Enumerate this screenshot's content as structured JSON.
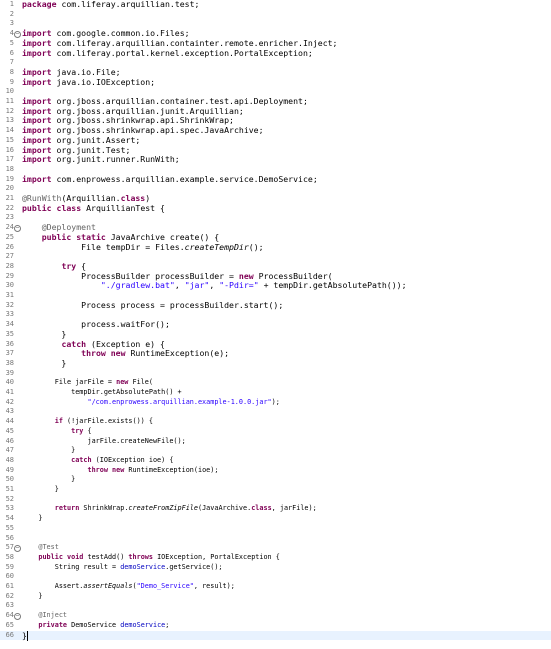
{
  "editor": {
    "language": "java",
    "highlight_line": 66,
    "colors": {
      "keyword": "#7f0055",
      "string": "#2a00ff",
      "annotation": "#646464",
      "field": "#0000c0",
      "line_number": "#787878",
      "current_line": "#e8f2fe"
    },
    "lines": [
      {
        "n": 1,
        "tokens": [
          [
            "kw",
            "package"
          ],
          [
            "t",
            " com.liferay.arquillian.test;"
          ]
        ]
      },
      {
        "n": 2,
        "tokens": []
      },
      {
        "n": 3,
        "tokens": []
      },
      {
        "n": 4,
        "fold": true,
        "tokens": [
          [
            "kw",
            "import"
          ],
          [
            "t",
            " com.google.common.io.Files;"
          ]
        ]
      },
      {
        "n": 5,
        "tokens": [
          [
            "kw",
            "import"
          ],
          [
            "t",
            " com.liferay.arquillian.containter.remote.enricher.Inject;"
          ]
        ]
      },
      {
        "n": 6,
        "tokens": [
          [
            "kw",
            "import"
          ],
          [
            "t",
            " com.liferay.portal.kernel.exception.PortalException;"
          ]
        ]
      },
      {
        "n": 7,
        "tokens": []
      },
      {
        "n": 8,
        "tokens": [
          [
            "kw",
            "import"
          ],
          [
            "t",
            " java.io.File;"
          ]
        ]
      },
      {
        "n": 9,
        "tokens": [
          [
            "kw",
            "import"
          ],
          [
            "t",
            " java.io.IOException;"
          ]
        ]
      },
      {
        "n": 10,
        "tokens": []
      },
      {
        "n": 11,
        "tokens": [
          [
            "kw",
            "import"
          ],
          [
            "t",
            " org.jboss.arquillian.container.test.api.Deployment;"
          ]
        ]
      },
      {
        "n": 12,
        "tokens": [
          [
            "kw",
            "import"
          ],
          [
            "t",
            " org.jboss.arquillian.junit.Arquillian;"
          ]
        ]
      },
      {
        "n": 13,
        "tokens": [
          [
            "kw",
            "import"
          ],
          [
            "t",
            " org.jboss.shrinkwrap.api.ShrinkWrap;"
          ]
        ]
      },
      {
        "n": 14,
        "tokens": [
          [
            "kw",
            "import"
          ],
          [
            "t",
            " org.jboss.shrinkwrap.api.spec.JavaArchive;"
          ]
        ]
      },
      {
        "n": 15,
        "tokens": [
          [
            "kw",
            "import"
          ],
          [
            "t",
            " org.junit.Assert;"
          ]
        ]
      },
      {
        "n": 16,
        "tokens": [
          [
            "kw",
            "import"
          ],
          [
            "t",
            " org.junit.Test;"
          ]
        ]
      },
      {
        "n": 17,
        "tokens": [
          [
            "kw",
            "import"
          ],
          [
            "t",
            " org.junit.runner.RunWith;"
          ]
        ]
      },
      {
        "n": 18,
        "tokens": []
      },
      {
        "n": 19,
        "tokens": [
          [
            "kw",
            "import"
          ],
          [
            "t",
            " com.enprowess.arquillian.example.service.DemoService;"
          ]
        ]
      },
      {
        "n": 20,
        "tokens": []
      },
      {
        "n": 21,
        "tokens": [
          [
            "ann",
            "@RunWith"
          ],
          [
            "t",
            "(Arquillian."
          ],
          [
            "kw",
            "class"
          ],
          [
            "t",
            ")"
          ]
        ]
      },
      {
        "n": 22,
        "tokens": [
          [
            "kw",
            "public"
          ],
          [
            "t",
            " "
          ],
          [
            "kw",
            "class"
          ],
          [
            "t",
            " ArquillianTest {"
          ]
        ]
      },
      {
        "n": 23,
        "tokens": []
      },
      {
        "n": 24,
        "fold": true,
        "tokens": [
          [
            "t",
            "    "
          ],
          [
            "ann",
            "@Deployment"
          ]
        ]
      },
      {
        "n": 25,
        "tokens": [
          [
            "t",
            "    "
          ],
          [
            "kw",
            "public"
          ],
          [
            "t",
            " "
          ],
          [
            "kw",
            "static"
          ],
          [
            "t",
            " JavaArchive create() {"
          ]
        ]
      },
      {
        "n": 26,
        "tokens": [
          [
            "t",
            "            File tempDir = Files."
          ],
          [
            "sm",
            "createTempDir"
          ],
          [
            "t",
            "();"
          ]
        ]
      },
      {
        "n": 27,
        "tokens": []
      },
      {
        "n": 28,
        "tokens": [
          [
            "t",
            "        "
          ],
          [
            "kw",
            "try"
          ],
          [
            "t",
            " {"
          ]
        ]
      },
      {
        "n": 29,
        "tokens": [
          [
            "t",
            "            ProcessBuilder processBuilder = "
          ],
          [
            "kw",
            "new"
          ],
          [
            "t",
            " ProcessBuilder("
          ]
        ]
      },
      {
        "n": 30,
        "tokens": [
          [
            "t",
            "                "
          ],
          [
            "str",
            "\"./gradlew.bat\""
          ],
          [
            "t",
            ", "
          ],
          [
            "str",
            "\"jar\""
          ],
          [
            "t",
            ", "
          ],
          [
            "str",
            "\"-Pdir=\""
          ],
          [
            "t",
            " + tempDir.getAbsolutePath());"
          ]
        ]
      },
      {
        "n": 31,
        "tokens": []
      },
      {
        "n": 32,
        "tokens": [
          [
            "t",
            "            Process process = processBuilder.start();"
          ]
        ]
      },
      {
        "n": 33,
        "tokens": []
      },
      {
        "n": 34,
        "tokens": [
          [
            "t",
            "            process.waitFor();"
          ]
        ]
      },
      {
        "n": 35,
        "tokens": [
          [
            "t",
            "        }"
          ]
        ]
      },
      {
        "n": 36,
        "tokens": [
          [
            "t",
            "        "
          ],
          [
            "kw",
            "catch"
          ],
          [
            "t",
            " (Exception e) {"
          ]
        ]
      },
      {
        "n": 37,
        "tokens": [
          [
            "t",
            "            "
          ],
          [
            "kw",
            "throw"
          ],
          [
            "t",
            " "
          ],
          [
            "kw",
            "new"
          ],
          [
            "t",
            " RuntimeException(e);"
          ]
        ]
      },
      {
        "n": 38,
        "tokens": [
          [
            "t",
            "        }"
          ]
        ]
      },
      {
        "n": 39,
        "tokens": []
      },
      {
        "n": 40,
        "small": true,
        "tokens": [
          [
            "t",
            "        File jarFile = "
          ],
          [
            "kw",
            "new"
          ],
          [
            "t",
            " File("
          ]
        ]
      },
      {
        "n": 41,
        "small": true,
        "tokens": [
          [
            "t",
            "            tempDir.getAbsolutePath() +"
          ]
        ]
      },
      {
        "n": 42,
        "small": true,
        "tokens": [
          [
            "t",
            "                "
          ],
          [
            "str",
            "\"/com.enprowess.arquillian.example-1.0.0.jar\""
          ],
          [
            "t",
            ");"
          ]
        ]
      },
      {
        "n": 43,
        "small": true,
        "tokens": []
      },
      {
        "n": 44,
        "small": true,
        "tokens": [
          [
            "t",
            "        "
          ],
          [
            "kw",
            "if"
          ],
          [
            "t",
            " (!jarFile.exists()) {"
          ]
        ]
      },
      {
        "n": 45,
        "small": true,
        "tokens": [
          [
            "t",
            "            "
          ],
          [
            "kw",
            "try"
          ],
          [
            "t",
            " {"
          ]
        ]
      },
      {
        "n": 46,
        "small": true,
        "tokens": [
          [
            "t",
            "                jarFile.createNewFile();"
          ]
        ]
      },
      {
        "n": 47,
        "small": true,
        "tokens": [
          [
            "t",
            "            }"
          ]
        ]
      },
      {
        "n": 48,
        "small": true,
        "tokens": [
          [
            "t",
            "            "
          ],
          [
            "kw",
            "catch"
          ],
          [
            "t",
            " (IOException ioe) {"
          ]
        ]
      },
      {
        "n": 49,
        "small": true,
        "tokens": [
          [
            "t",
            "                "
          ],
          [
            "kw",
            "throw"
          ],
          [
            "t",
            " "
          ],
          [
            "kw",
            "new"
          ],
          [
            "t",
            " RuntimeException(ioe);"
          ]
        ]
      },
      {
        "n": 50,
        "small": true,
        "tokens": [
          [
            "t",
            "            }"
          ]
        ]
      },
      {
        "n": 51,
        "small": true,
        "tokens": [
          [
            "t",
            "        }"
          ]
        ]
      },
      {
        "n": 52,
        "small": true,
        "tokens": []
      },
      {
        "n": 53,
        "small": true,
        "tokens": [
          [
            "t",
            "        "
          ],
          [
            "kw",
            "return"
          ],
          [
            "t",
            " ShrinkWrap."
          ],
          [
            "sm",
            "createFromZipFile"
          ],
          [
            "t",
            "(JavaArchive."
          ],
          [
            "kw",
            "class"
          ],
          [
            "t",
            ", jarFile);"
          ]
        ]
      },
      {
        "n": 54,
        "small": true,
        "tokens": [
          [
            "t",
            "    }"
          ]
        ]
      },
      {
        "n": 55,
        "small": true,
        "tokens": []
      },
      {
        "n": 56,
        "small": true,
        "tokens": []
      },
      {
        "n": 57,
        "small": true,
        "fold": true,
        "tokens": [
          [
            "t",
            "    "
          ],
          [
            "ann",
            "@Test"
          ]
        ]
      },
      {
        "n": 58,
        "small": true,
        "tokens": [
          [
            "t",
            "    "
          ],
          [
            "kw",
            "public"
          ],
          [
            "t",
            " "
          ],
          [
            "kw",
            "void"
          ],
          [
            "t",
            " testAdd() "
          ],
          [
            "kw",
            "throws"
          ],
          [
            "t",
            " IOException, PortalException {"
          ]
        ]
      },
      {
        "n": 59,
        "small": true,
        "tokens": [
          [
            "t",
            "        String result = "
          ],
          [
            "fld",
            "demoService"
          ],
          [
            "t",
            ".getService();"
          ]
        ]
      },
      {
        "n": 60,
        "small": true,
        "tokens": []
      },
      {
        "n": 61,
        "small": true,
        "tokens": [
          [
            "t",
            "        Assert."
          ],
          [
            "sm",
            "assertEquals"
          ],
          [
            "t",
            "("
          ],
          [
            "str",
            "\"Demo_Service\""
          ],
          [
            "t",
            ", result);"
          ]
        ]
      },
      {
        "n": 62,
        "small": true,
        "tokens": [
          [
            "t",
            "    }"
          ]
        ]
      },
      {
        "n": 63,
        "small": true,
        "tokens": []
      },
      {
        "n": 64,
        "small": true,
        "fold": true,
        "tokens": [
          [
            "t",
            "    "
          ],
          [
            "ann",
            "@Inject"
          ]
        ]
      },
      {
        "n": 65,
        "small": true,
        "tokens": [
          [
            "t",
            "    "
          ],
          [
            "kw",
            "private"
          ],
          [
            "t",
            " DemoService "
          ],
          [
            "fld",
            "demoService"
          ],
          [
            "t",
            ";"
          ]
        ]
      },
      {
        "n": 66,
        "tokens": [
          [
            "t",
            "}"
          ]
        ]
      }
    ]
  }
}
